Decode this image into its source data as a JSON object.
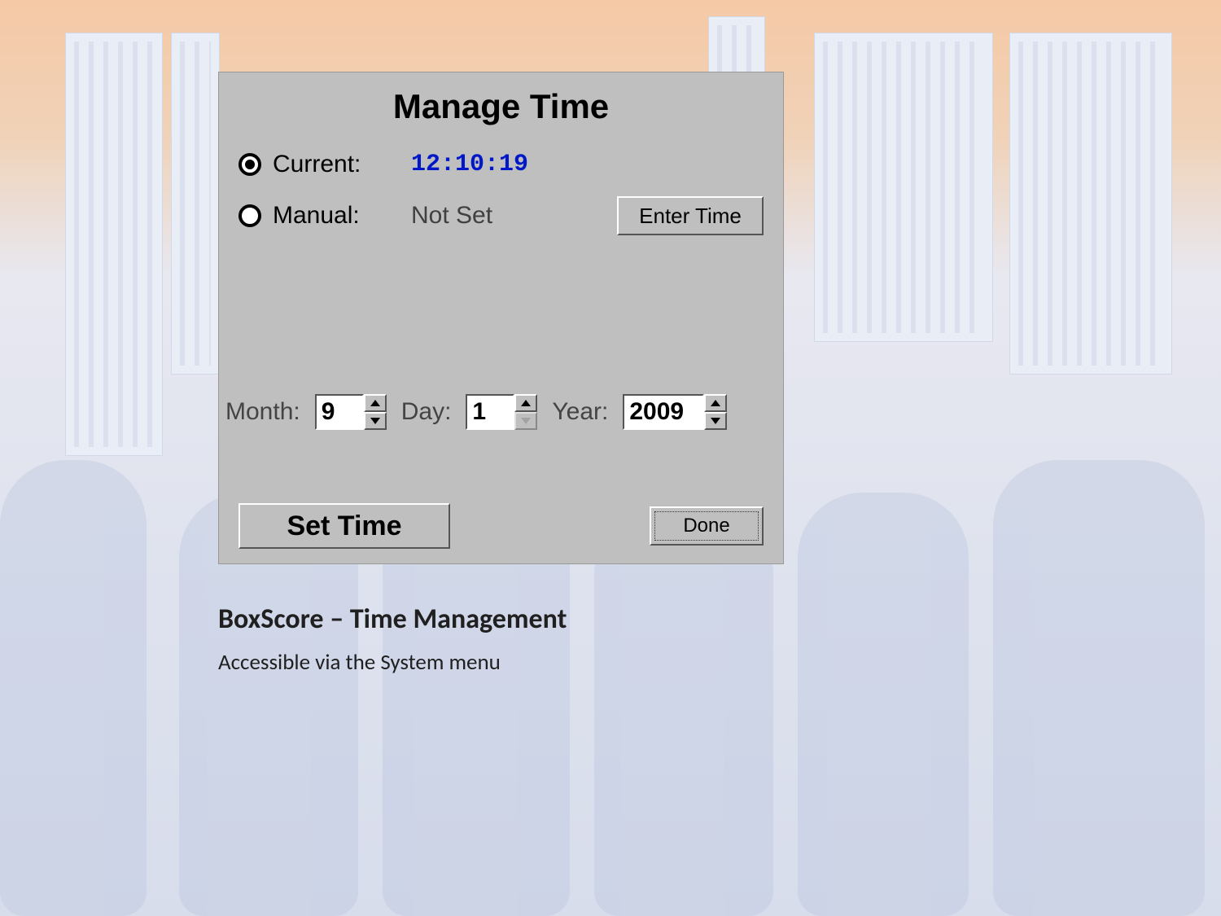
{
  "dialog": {
    "title": "Manage Time",
    "options": {
      "current": {
        "label": "Current:",
        "value": "12:10:19",
        "selected": true
      },
      "manual": {
        "label": "Manual:",
        "value": "Not Set",
        "selected": false
      }
    },
    "enter_time_label": "Enter Time",
    "date": {
      "month_label": "Month:",
      "month_value": "9",
      "day_label": "Day:",
      "day_value": "1",
      "year_label": "Year:",
      "year_value": "2009"
    },
    "set_time_label": "Set Time",
    "done_label": "Done"
  },
  "caption": {
    "title": "BoxScore – Time Management",
    "subtitle": "Accessible via the System menu"
  }
}
